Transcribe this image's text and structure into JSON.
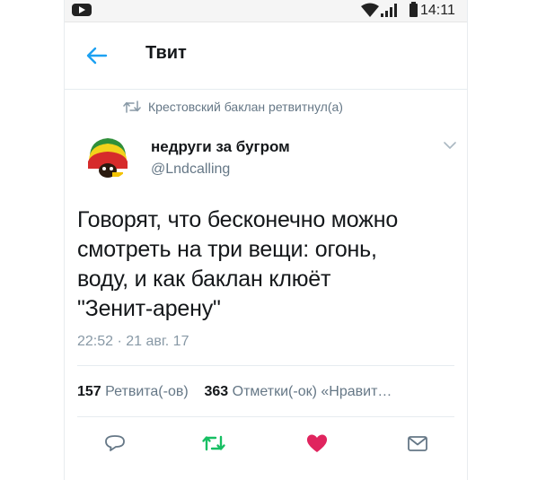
{
  "status_bar": {
    "time": "14:11",
    "icons": [
      "media-icon",
      "wifi-icon",
      "signal-icon",
      "battery-icon"
    ]
  },
  "header": {
    "title": "Твит",
    "back_icon": "back-arrow-icon"
  },
  "retweet": {
    "text": "Крестовский баклан ретвитнул(а)",
    "icon": "retweet-icon"
  },
  "author": {
    "name": "недруги за бугром",
    "handle": "@Lndcalling"
  },
  "tweet": {
    "text": "Говорят, что бесконечно можно\nсмотреть на три вещи: огонь,\nводу, и как баклан клюёт\n\"Зенит-арену\"",
    "timestamp": "22:52 · 21 авг. 17"
  },
  "stats": {
    "retweets_count": "157",
    "retweets_label": "Ретвита(-ов)",
    "likes_count": "363",
    "likes_label": "Отметки(-ок) «Нравит…"
  },
  "actions": {
    "reply_icon": "reply-icon",
    "retweet_icon": "retweet-icon",
    "like_icon": "heart-icon",
    "message_icon": "envelope-icon"
  },
  "colors": {
    "accent": "#1da1f2",
    "retweet_active": "#17bf63",
    "like_active": "#e0245e",
    "secondary_text": "#657786"
  }
}
